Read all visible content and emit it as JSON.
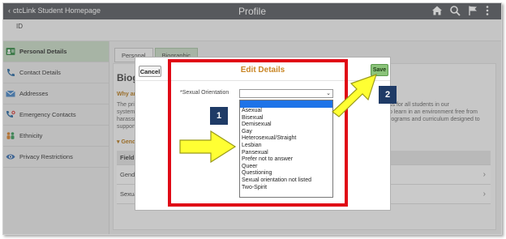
{
  "header": {
    "back_label": "ctcLink Student Homepage",
    "title": "Profile",
    "icons": [
      "home-icon",
      "search-icon",
      "flag-icon",
      "more-vertical-icon"
    ]
  },
  "subheader": {
    "id_label": "ID"
  },
  "sidebar": {
    "items": [
      {
        "label": "Personal Details",
        "icon": "person-card-icon",
        "active": true
      },
      {
        "label": "Contact Details",
        "icon": "phone-icon"
      },
      {
        "label": "Addresses",
        "icon": "envelope-icon"
      },
      {
        "label": "Emergency Contacts",
        "icon": "emergency-contact-icon"
      },
      {
        "label": "Ethnicity",
        "icon": "people-icon"
      },
      {
        "label": "Privacy Restrictions",
        "icon": "eye-icon"
      }
    ]
  },
  "tabs": [
    {
      "label": "Personal"
    },
    {
      "label": "Biographic",
      "active": true
    }
  ],
  "background": {
    "heading": "Biogra",
    "why": "Why are",
    "para_left": [
      "The prim",
      "system,",
      "harassm",
      "support s"
    ],
    "para_right": [
      "ss for all students in our",
      "o learn in an environment free from",
      "rograms and curriculum designed to"
    ],
    "gender_section": "Gend",
    "table_header": "Field",
    "rows": [
      "Gende",
      "Sexual"
    ]
  },
  "modal": {
    "cancel_label": "Cancel",
    "title": "Edit Details",
    "save_label": "Save",
    "field_label": "*Sexual Orientation",
    "selected_value": "",
    "options": [
      "",
      "Asexual",
      "Bisexual",
      "Demisexual",
      "Gay",
      "Heterosexual/Straight",
      "Lesbian",
      "Pansexual",
      "Prefer not to answer",
      "Queer",
      "Questioning",
      "Sexual orientation not listed",
      "Two-Spirit"
    ]
  },
  "annotations": {
    "badge_1": "1",
    "badge_2": "2",
    "highlight_color": "#e00a16",
    "arrow_color": "#ffff33",
    "badge_color": "#1f3b66"
  }
}
